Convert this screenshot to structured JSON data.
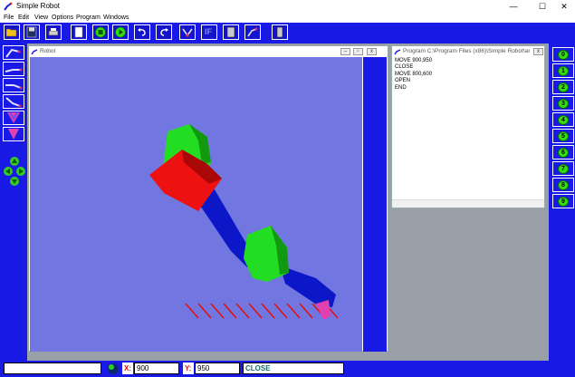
{
  "app": {
    "title": "Simple Robot"
  },
  "window_controls": {
    "minimize": "—",
    "maximize": "☐",
    "close": "✕"
  },
  "menu": [
    "File",
    "Edit",
    "View",
    "Options",
    "Program",
    "Windows"
  ],
  "toolbar": {
    "if_label": "IF"
  },
  "robot_window": {
    "title": "Robot"
  },
  "program_window": {
    "title": "Program C:\\Program Files (x86)\\Simple Robot\\ar1...",
    "lines": [
      "MOVE 900,950",
      "CLOSE",
      "MOVE 800,600",
      "OPEN",
      "END"
    ]
  },
  "number_buttons": [
    "0",
    "1",
    "2",
    "3",
    "4",
    "5",
    "6",
    "7",
    "8",
    "9"
  ],
  "status": {
    "x_label": "X:",
    "x_value": "900",
    "y_label": "Y:",
    "y_value": "950",
    "state": "CLOSE"
  },
  "colors": {
    "accent": "#1a1ae6",
    "view_bg": "#7276e0",
    "arm": "#0c18c8",
    "joint_green": "#22dd22",
    "gripper_red": "#ee1111",
    "target": "#e01010"
  }
}
